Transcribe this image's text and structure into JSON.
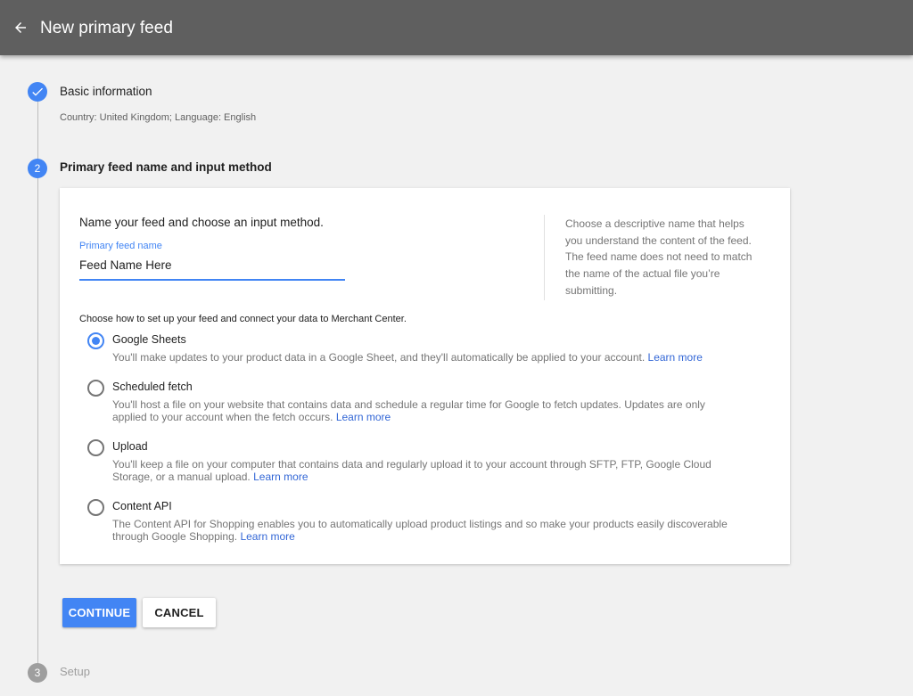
{
  "header": {
    "title": "New primary feed",
    "back_icon": "arrow-left-icon"
  },
  "colors": {
    "header_bg": "#5f5f5f",
    "accent": "#4285f4",
    "link": "#3367d6",
    "inactive_step": "#9e9e9e"
  },
  "steps": [
    {
      "number": "1",
      "title": "Basic information",
      "subtitle": "Country: United Kingdom; Language: English",
      "status": "complete",
      "icon": "check-icon"
    },
    {
      "number": "2",
      "title": "Primary feed name and input method",
      "status": "active"
    },
    {
      "number": "3",
      "title": "Setup",
      "status": "inactive"
    }
  ],
  "form": {
    "heading": "Name your feed and choose an input method.",
    "feed_name_label": "Primary feed name",
    "feed_name_value": "Feed Name Here",
    "help_text": "Choose a descriptive name that helps you understand the content of the feed. The feed name does not need to match the name of the actual file you’re submitting.",
    "choose_text": "Choose how to set up your feed and connect your data to Merchant Center.",
    "learn_more": "Learn more",
    "options": [
      {
        "label": "Google Sheets",
        "description": "You'll make updates to your product data in a Google Sheet, and they'll automatically be applied to your account.",
        "selected": true
      },
      {
        "label": "Scheduled fetch",
        "description": "You'll host a file on your website that contains data and schedule a regular time for Google to fetch updates. Updates are only applied to your account when the fetch occurs.",
        "selected": false
      },
      {
        "label": "Upload",
        "description": "You'll keep a file on your computer that contains data and regularly upload it to your account through SFTP, FTP, Google Cloud Storage, or a manual upload.",
        "selected": false
      },
      {
        "label": "Content API",
        "description": "The Content API for Shopping enables you to automatically upload product listings and so make your products easily discoverable through Google Shopping.",
        "selected": false
      }
    ]
  },
  "buttons": {
    "continue": "CONTINUE",
    "cancel": "CANCEL"
  }
}
